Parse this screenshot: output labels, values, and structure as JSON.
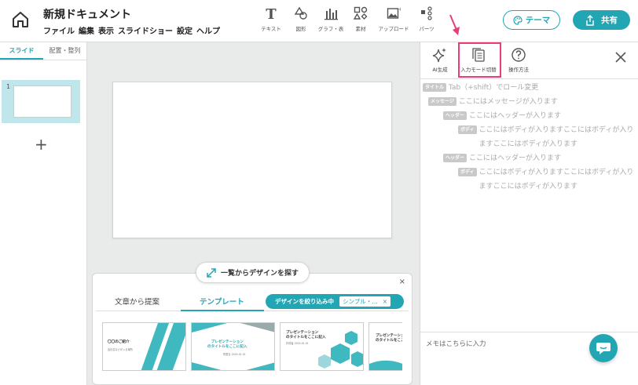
{
  "header": {
    "title": "新規ドキュメント",
    "menu": [
      "ファイル",
      "編集",
      "表示",
      "スライドショー",
      "設定",
      "ヘルプ"
    ],
    "tools": [
      {
        "label": "テキスト",
        "icon": "text-icon"
      },
      {
        "label": "図形",
        "icon": "shape-icon"
      },
      {
        "label": "グラフ・表",
        "icon": "chart-icon"
      },
      {
        "label": "素材",
        "icon": "assets-icon"
      },
      {
        "label": "アップロード",
        "icon": "upload-icon"
      },
      {
        "label": "パーツ",
        "icon": "parts-icon"
      }
    ],
    "theme_label": "テーマ",
    "share_label": "共有"
  },
  "sidebar": {
    "tabs": [
      "スライド",
      "配置・整列"
    ],
    "slide_number": "1",
    "add_symbol": "+"
  },
  "template_panel": {
    "browse_label": "一覧からデザインを探す",
    "close_symbol": "×",
    "tabs": [
      "文章から提案",
      "テンプレート"
    ],
    "filter_label": "デザインを絞り込み中",
    "filter_value": "シンプル・…",
    "filter_clear": "×",
    "cards": [
      {
        "title": "〇〇のご紹介",
        "subtitle": "会社名などが入る場所"
      },
      {
        "title": "プレゼンテーション\nのタイトルをここに記入",
        "subtitle": "所属名 2024.01.01"
      },
      {
        "title": "プレゼンテーション\nのタイトルをここに記入",
        "subtitle": "作成者 2024.01.01"
      },
      {
        "title": "プレゼンテーション\nのタイトルをここ",
        "subtitle": ""
      }
    ]
  },
  "right_panel": {
    "tools": [
      {
        "label": "AI生成",
        "icon": "sparkle-icon"
      },
      {
        "label": "入力モード切替",
        "icon": "copy-icon"
      },
      {
        "label": "操作方法",
        "icon": "help-icon"
      }
    ],
    "rows": [
      {
        "tag": "タイトル",
        "text": "Tab（+shift）でロール変更"
      },
      {
        "tag": "メッセージ",
        "text": "ここにはメッセージが入ります"
      },
      {
        "tag": "ヘッダー",
        "text": "ここにはヘッダーが入ります"
      },
      {
        "tag": "ボディ",
        "text": "ここにはボディが入りますここにはボディが入りますここにはボディが入ります"
      },
      {
        "tag": "ヘッダー",
        "text": "ここにはヘッダーが入ります"
      },
      {
        "tag": "ボディ",
        "text": "ここにはボディが入りますここにはボディが入りますここにはボディが入ります"
      }
    ],
    "memo_placeholder": "メモはこちらに入力"
  },
  "colors": {
    "accent": "#23a6b3",
    "highlight": "#ea3b7b"
  }
}
